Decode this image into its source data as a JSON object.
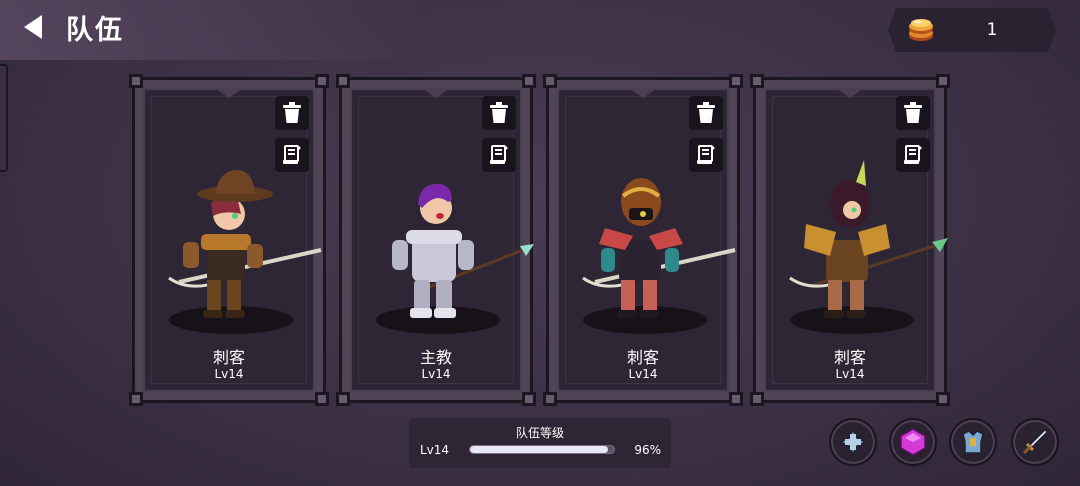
{
  "header": {
    "title": "队伍",
    "back_icon": "back-arrow-icon"
  },
  "currency": {
    "icon": "coin-stack-icon",
    "value": "1"
  },
  "cards": [
    {
      "name": "刺客",
      "level": "Lv14",
      "style": "cowboy-hat-assassin",
      "weapon": "spear-sword"
    },
    {
      "name": "主教",
      "level": "Lv14",
      "style": "silver-armored-bishop",
      "weapon": "spear"
    },
    {
      "name": "刺客",
      "level": "Lv14",
      "style": "red-gold-helmet-assassin",
      "weapon": "spear-sword"
    },
    {
      "name": "刺客",
      "level": "Lv14",
      "style": "gold-horned-assassin",
      "weapon": "green-spear-sword"
    }
  ],
  "card_actions": {
    "delete_icon": "trash-icon",
    "detail_icon": "scroll-list-icon"
  },
  "team_level": {
    "title": "队伍等级",
    "level": "Lv14",
    "progress": 0.96,
    "percent_label": "96%"
  },
  "bottom_buttons": [
    {
      "icon": "crosshair-helmet-icon"
    },
    {
      "icon": "purple-gem-icon"
    },
    {
      "icon": "chest-armor-icon"
    },
    {
      "icon": "sword-icon"
    }
  ],
  "colors": {
    "background": "#3d3146",
    "card_frame": "#514457",
    "card_inner": "#2e2634",
    "bar_fill": "#e6e8f6",
    "gem": "#d43ad8"
  }
}
